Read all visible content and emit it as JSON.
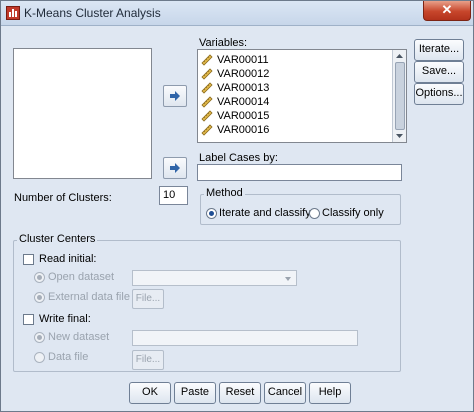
{
  "window": {
    "title": "K-Means Cluster Analysis",
    "close_glyph": "✕"
  },
  "source_list": {
    "items": []
  },
  "variables": {
    "label": "Variables:",
    "items": [
      "VAR00011",
      "VAR00012",
      "VAR00013",
      "VAR00014",
      "VAR00015",
      "VAR00016"
    ]
  },
  "label_cases": {
    "label": "Label Cases by:",
    "value": ""
  },
  "clusters": {
    "label": "Number of Clusters:",
    "value": "10"
  },
  "method": {
    "legend": "Method",
    "options": [
      {
        "label": "Iterate and classify",
        "checked": true
      },
      {
        "label": "Classify only",
        "checked": false
      }
    ]
  },
  "cluster_centers": {
    "legend": "Cluster Centers",
    "read_initial": {
      "label": "Read initial:",
      "checked": false
    },
    "open_dataset": {
      "label": "Open dataset",
      "checked": true
    },
    "external_file": {
      "label": "External data file",
      "checked": true,
      "button": "File..."
    },
    "write_final": {
      "label": "Write final:",
      "checked": false
    },
    "new_dataset": {
      "label": "New dataset",
      "checked": true
    },
    "data_file": {
      "label": "Data file",
      "checked": false,
      "button": "File..."
    }
  },
  "side_buttons": {
    "iterate": "Iterate...",
    "save": "Save...",
    "options": "Options..."
  },
  "bottom_buttons": {
    "ok": "OK",
    "paste": "Paste",
    "reset": "Reset",
    "cancel": "Cancel",
    "help": "Help"
  }
}
